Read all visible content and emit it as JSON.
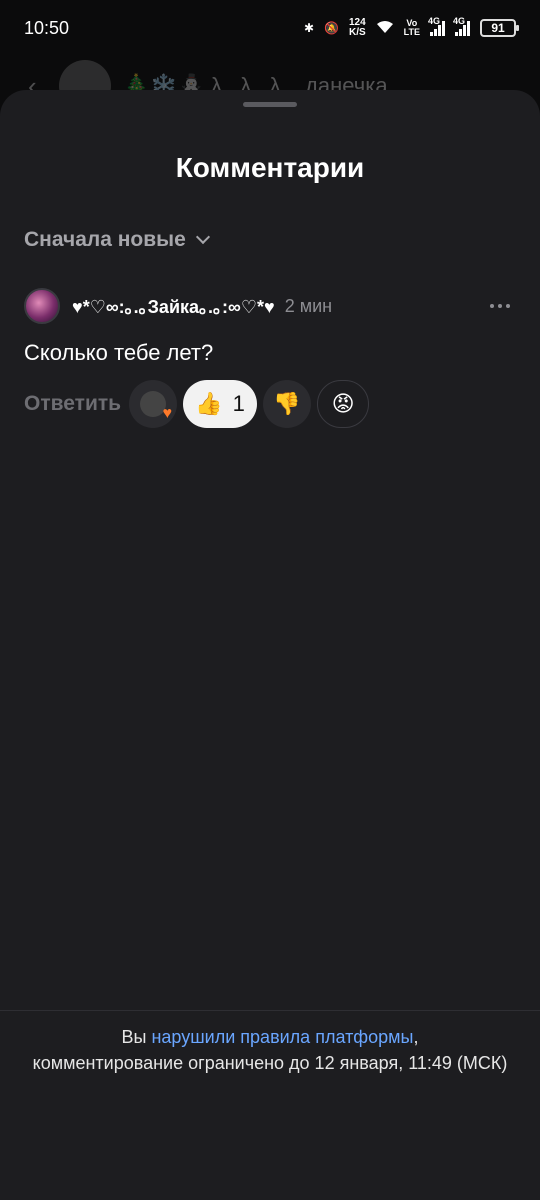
{
  "status_bar": {
    "time": "10:50",
    "net_speed_value": "124",
    "net_speed_unit": "K/S",
    "volte_top": "Vo",
    "volte_bottom": "LTE",
    "sig1_label": "4G",
    "sig2_label": "4G",
    "battery": "91"
  },
  "background_header": {
    "back_icon": "back-arrow-icon",
    "title": "🎄❄️⛄ λ...λ...λ... данечка..."
  },
  "sheet": {
    "title": "Комментарии",
    "sort_label": "Сначала новые"
  },
  "comment": {
    "author": "♥*♡∞:｡.｡Зайка｡.｡:∞♡*♥",
    "time": "2 мин",
    "text": "Сколько тебе лет?",
    "reply_label": "Ответить",
    "reactions": {
      "like_emoji": "👍",
      "like_count": "1",
      "dislike_emoji": "👎",
      "angry_emoji": "😡"
    }
  },
  "footer": {
    "prefix": "Вы ",
    "link": "нарушили правила платформы",
    "suffix": ",",
    "line2": "комментирование ограничено до 12 января, 11:49 (МСК)"
  }
}
